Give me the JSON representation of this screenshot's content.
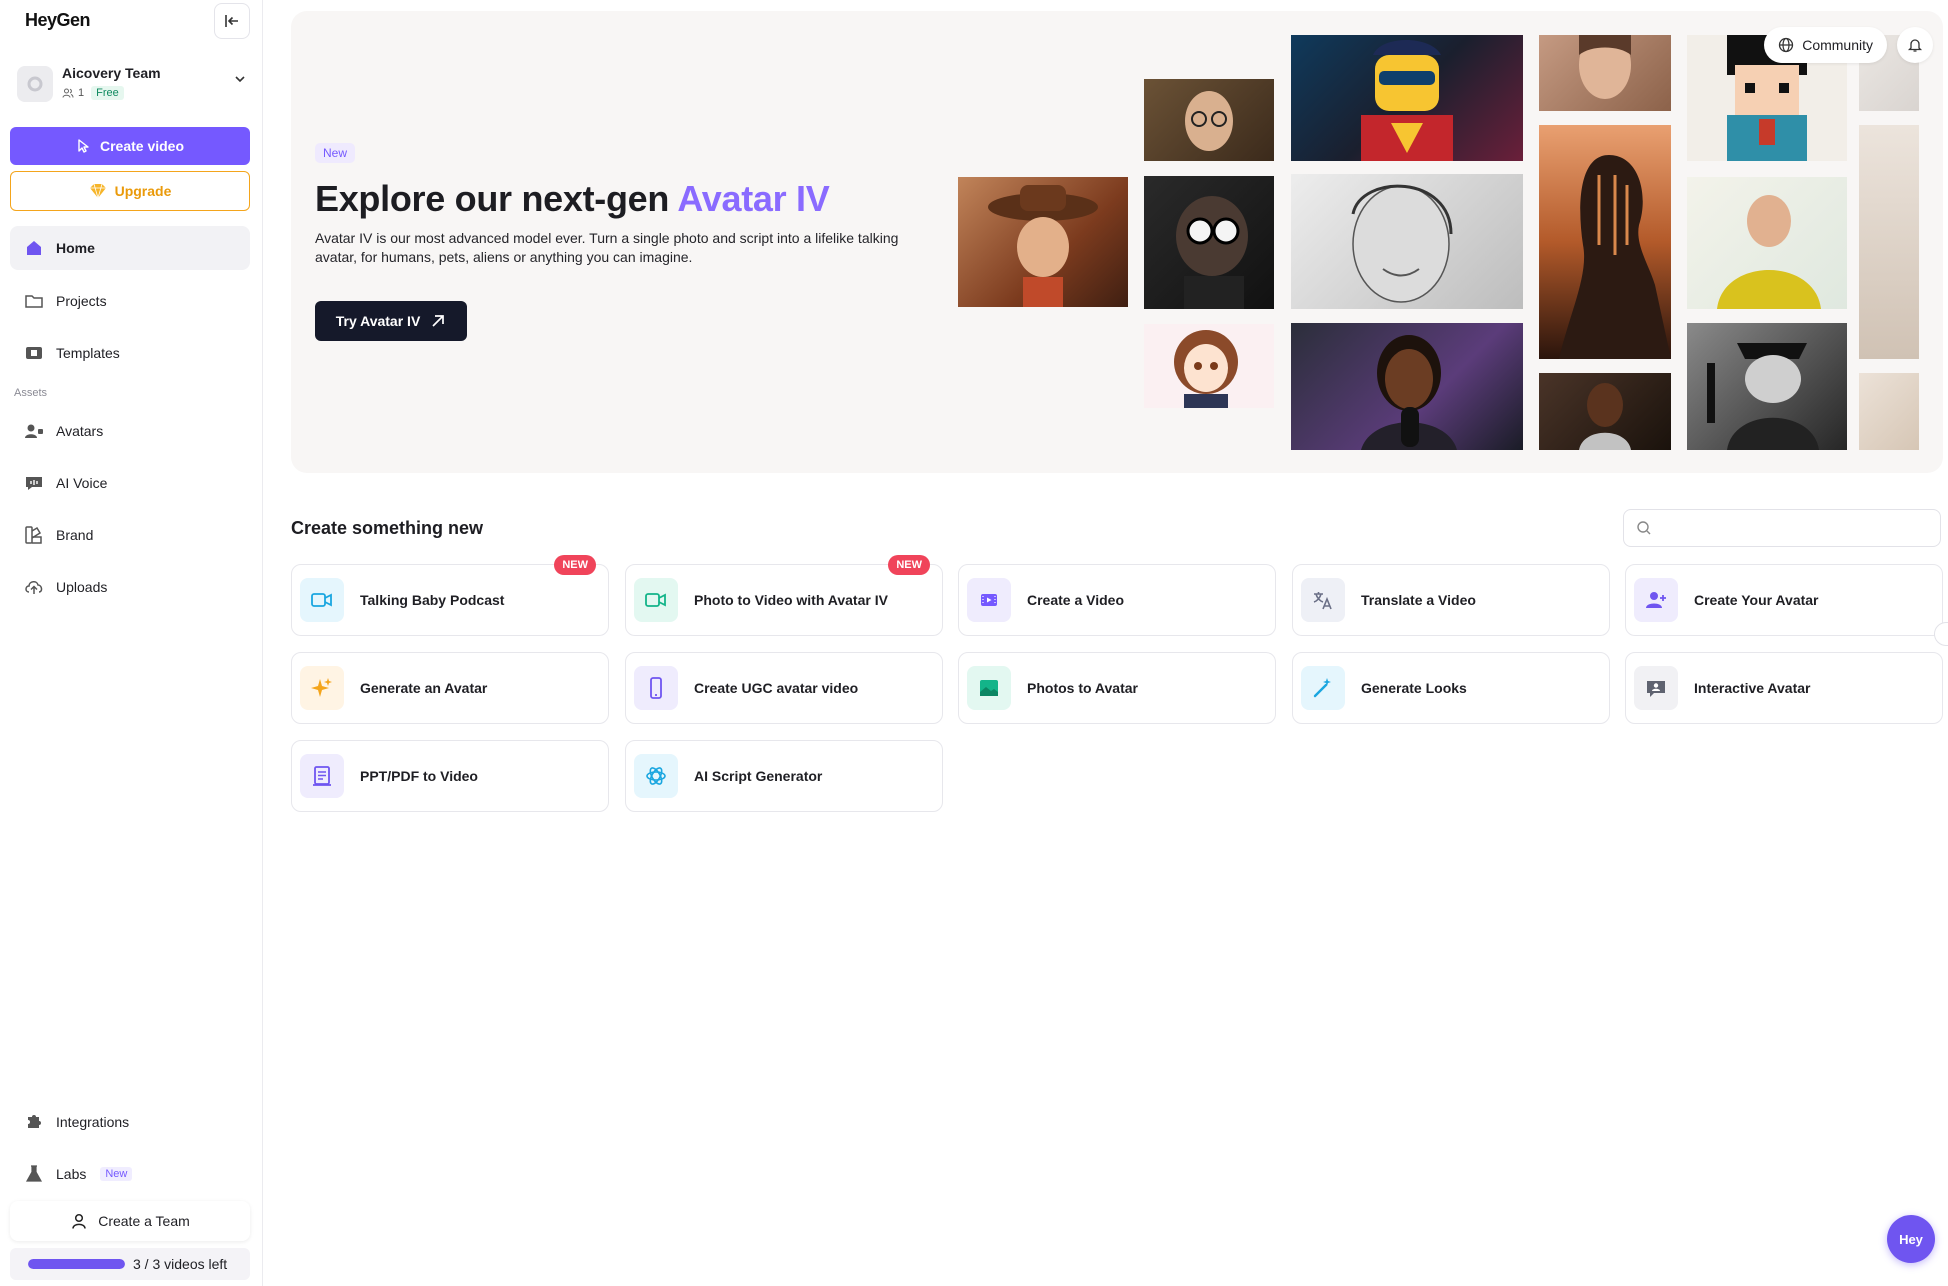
{
  "app": {
    "logo": "HeyGen"
  },
  "team": {
    "name": "Aicovery Team",
    "members": "1",
    "plan": "Free"
  },
  "sidebar": {
    "create_video": "Create video",
    "upgrade": "Upgrade",
    "items": [
      {
        "label": "Home",
        "icon": "home-icon",
        "active": true
      },
      {
        "label": "Projects",
        "icon": "folder-icon"
      },
      {
        "label": "Templates",
        "icon": "templates-icon"
      }
    ],
    "assets_header": "Assets",
    "asset_items": [
      {
        "label": "Avatars",
        "icon": "avatar-icon"
      },
      {
        "label": "AI Voice",
        "icon": "voice-icon"
      },
      {
        "label": "Brand",
        "icon": "brand-icon"
      },
      {
        "label": "Uploads",
        "icon": "upload-icon"
      }
    ],
    "bottom_items": [
      {
        "label": "Integrations",
        "icon": "puzzle-icon"
      },
      {
        "label": "Labs",
        "icon": "flask-icon",
        "badge": "New"
      }
    ],
    "create_team": "Create a Team",
    "videos_left": "3 / 3 videos left",
    "videos_progress": 1.0
  },
  "hero": {
    "badge": "New",
    "title_prefix": "Explore our next-gen ",
    "title_accent": "Avatar IV",
    "description": "Avatar IV is our most advanced model ever. Turn a single photo and script into a lifelike talking avatar, for humans, pets, aliens or anything you can imagine.",
    "cta": "Try Avatar IV",
    "community": "Community"
  },
  "create_section": {
    "title": "Create something new",
    "search_placeholder": "",
    "cards": [
      {
        "label": "Talking Baby Podcast",
        "icon": "video-camera-icon",
        "badge": "NEW"
      },
      {
        "label": "Photo to Video with Avatar IV",
        "icon": "video-camera-icon",
        "badge": "NEW"
      },
      {
        "label": "Create a Video",
        "icon": "film-icon"
      },
      {
        "label": "Translate a Video",
        "icon": "translate-icon"
      },
      {
        "label": "Create Your Avatar",
        "icon": "user-plus-icon"
      },
      {
        "label": "Generate an Avatar",
        "icon": "sparkle-icon"
      },
      {
        "label": "Create UGC avatar video",
        "icon": "phone-icon"
      },
      {
        "label": "Photos to Avatar",
        "icon": "image-icon"
      },
      {
        "label": "Generate Looks",
        "icon": "magic-wand-icon"
      },
      {
        "label": "Interactive Avatar",
        "icon": "chat-avatar-icon"
      },
      {
        "label": "PPT/PDF to Video",
        "icon": "document-icon"
      },
      {
        "label": "AI Script Generator",
        "icon": "openai-icon"
      }
    ]
  },
  "chat_fab": "Hey",
  "colors": {
    "accent": "#7559ff",
    "upgrade": "#f4a51c",
    "new_badge": "#f0445a",
    "cta_dark": "#15192a"
  }
}
